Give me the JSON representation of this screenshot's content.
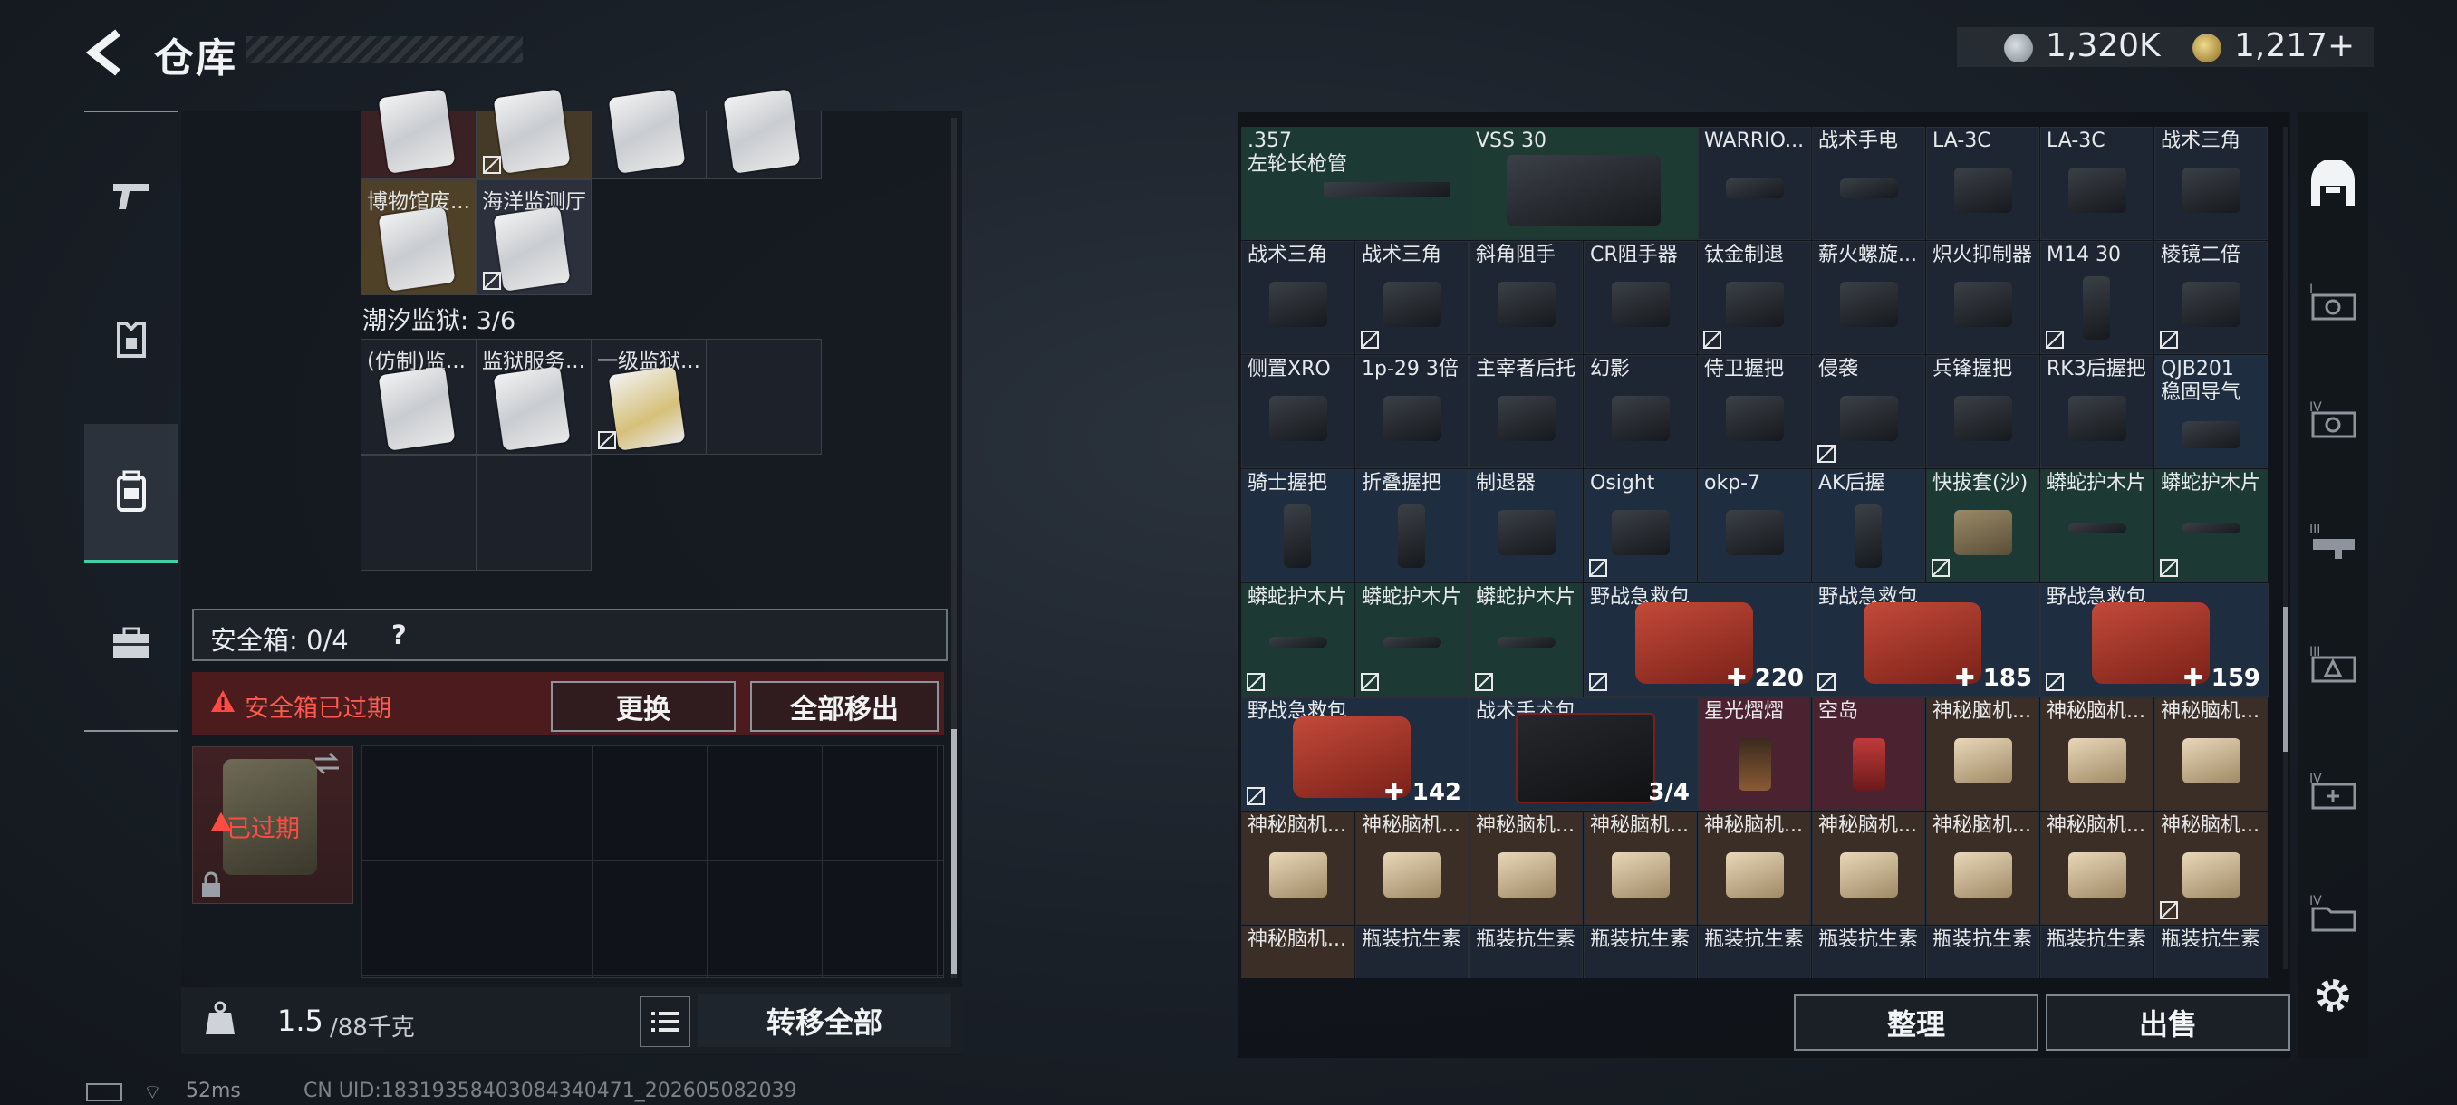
{
  "header": {
    "title": "仓库",
    "currency_silver": "1,320K",
    "currency_gold": "1,217+"
  },
  "left_panel": {
    "top_items": [
      {
        "label": "博物馆废..."
      },
      {
        "label": "海洋监测厅"
      }
    ],
    "prison_section": {
      "title": "潮汐监狱: 3/6"
    },
    "prison_items": [
      {
        "label": "(仿制)监..."
      },
      {
        "label": "监狱服务..."
      },
      {
        "label": "一级监狱..."
      }
    ],
    "safebox": {
      "title": "安全箱: 0/4",
      "help": "?",
      "expired_text": "安全箱已过期",
      "replace_label": "更换",
      "move_all_label": "全部移出",
      "case_status": "已过期"
    },
    "weight": {
      "value": "1.5",
      "unit": "/88千克"
    },
    "transfer_all_label": "转移全部"
  },
  "status_bar": {
    "ping": "52ms",
    "uid": "CN UID:18319358403084340471_202605082039"
  },
  "right_panel": {
    "rows": [
      [
        ".357\n左轮长枪管",
        "VSS 30",
        "WARRIO...",
        "战术手电",
        "LA-3C",
        "LA-3C",
        "战术三角"
      ],
      [
        "战术三角",
        "战术三角",
        "斜角阻手",
        "CR阻手器",
        "钛金制退",
        "薪火螺旋...",
        "炽火抑制器",
        "M14 30",
        "棱镜二倍"
      ],
      [
        "侧置XRO",
        "1p-29 3倍",
        "主宰者后托",
        "幻影",
        "侍卫握把",
        "侵袭",
        "兵锋握把",
        "RK3后握把",
        "QJB201\n稳固导气"
      ],
      [
        "骑士握把",
        "折叠握把",
        "制退器",
        "Osight",
        "okp-7",
        "AK后握",
        "快拔套(沙)",
        "蟒蛇护木片",
        "蟒蛇护木片"
      ],
      [
        "蟒蛇护木片",
        "蟒蛇护木片",
        "蟒蛇护木片",
        "野战急救包",
        "野战急救包",
        "野战急救包"
      ],
      [
        "野战急救包",
        "战术手术包",
        "星光熠熠",
        "空岛",
        "神秘脑机...",
        "神秘脑机..."
      ],
      [
        "神秘脑机...",
        "神秘脑机...",
        "神秘脑机...",
        "神秘脑机...",
        "神秘脑机...",
        "神秘脑机...",
        "神秘脑机...",
        "神秘脑机...",
        "神秘脑机..."
      ],
      [
        "神秘脑机...",
        "瓶装抗生素",
        "瓶装抗生素",
        "瓶装抗生素",
        "瓶装抗生素",
        "瓶装抗生素",
        "瓶装抗生素",
        "瓶装抗生素",
        "瓶装抗生素"
      ]
    ],
    "counts": {
      "medkit1": "220",
      "medkit2": "185",
      "medkit3": "159",
      "medkit4": "142",
      "surgery": "3/4"
    },
    "sort_label": "整理",
    "sell_label": "出售"
  },
  "right_nav": {
    "items": [
      "I",
      "IV",
      "III",
      "III",
      "IV",
      "IV"
    ]
  }
}
